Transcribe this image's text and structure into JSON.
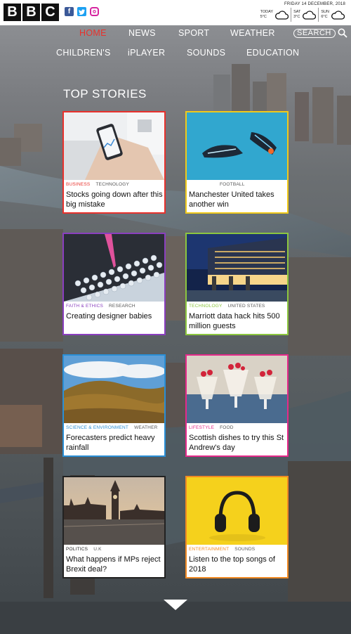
{
  "header": {
    "logo_letters": [
      "B",
      "B",
      "C"
    ],
    "social_icons": [
      "facebook-icon",
      "twitter-icon",
      "instagram-icon"
    ],
    "date": "FRIDAY 14 DECEMBER, 2018",
    "forecast": [
      {
        "day": "TODAY",
        "temp": "5°C",
        "icon": "cloud-icon"
      },
      {
        "day": "SAT",
        "temp": "3°C",
        "icon": "cloud-icon"
      },
      {
        "day": "SUN",
        "temp": "6°C",
        "icon": "cloud-icon"
      }
    ]
  },
  "nav": {
    "items": [
      {
        "label": "HOME",
        "active": true
      },
      {
        "label": "NEWS"
      },
      {
        "label": "SPORT"
      },
      {
        "label": "WEATHER"
      },
      {
        "label": "CHILDREN'S"
      },
      {
        "label": "iPLAYER"
      },
      {
        "label": "SOUNDS"
      },
      {
        "label": "EDUCATION"
      }
    ],
    "search_label": "SEARCH"
  },
  "section_title": "TOP STORIES",
  "cards": [
    {
      "category": "BUSINESS",
      "tag": "TECHNOLOGY",
      "headline": "Stocks going down after this big mistake",
      "accent": "#e8312c"
    },
    {
      "category": "",
      "tag": "FOOTBALL",
      "headline": "Manchester United takes another win",
      "accent": "#f0c91a"
    },
    {
      "category": "FAITH & ETHICS",
      "tag": "RESEARCH",
      "headline": "Creating designer babies",
      "accent": "#8a3fbf"
    },
    {
      "category": "TECHNOLOGY",
      "tag": "UNITED STATES",
      "headline": "Marriott data hack hits 500 million guests",
      "accent": "#8cc63f"
    },
    {
      "category": "SCIENCE & ENVIRONMENT",
      "tag": "WEATHER",
      "headline": "Forecasters predict heavy rainfall",
      "accent": "#2a8fd6"
    },
    {
      "category": "LIFESTYLE",
      "tag": "FOOD",
      "headline": "Scottish dishes to try this St Andrew's day",
      "accent": "#e52a8a"
    },
    {
      "category": "POLITICS",
      "tag": "U.K",
      "headline": "What happens if MPs reject Brexit deal?",
      "accent": "#222222"
    },
    {
      "category": "ENTERTAINMENT",
      "tag": "SOUNDS",
      "headline": "Listen to the top songs of 2018",
      "accent": "#f08a24"
    }
  ]
}
